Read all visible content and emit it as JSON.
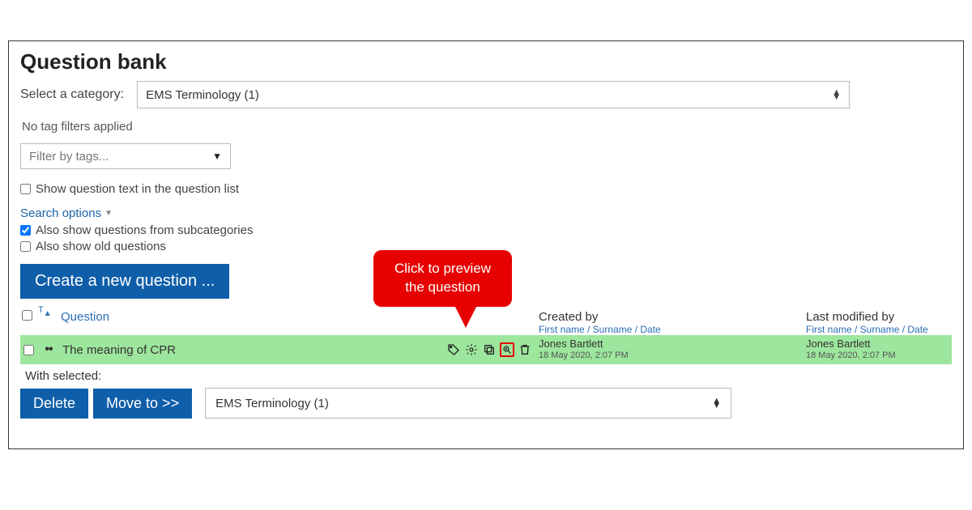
{
  "page": {
    "title": "Question bank"
  },
  "category": {
    "label": "Select a category:",
    "selected": "EMS Terminology (1)"
  },
  "tags": {
    "none_applied": "No tag filters applied",
    "placeholder": "Filter by tags..."
  },
  "options": {
    "show_text": {
      "label": "Show question text in the question list",
      "checked": false
    },
    "search_options": "Search options",
    "subcats": {
      "label": "Also show questions from subcategories",
      "checked": true
    },
    "old": {
      "label": "Also show old questions",
      "checked": false
    }
  },
  "create_button": "Create a new question ...",
  "table": {
    "type_abbr": "T",
    "question_header": "Question",
    "created_header": "Created by",
    "modified_header": "Last modified by",
    "sub_header": "First name / Surname / Date",
    "row": {
      "name": "The meaning of CPR",
      "created_by": "Jones Bartlett",
      "created_date": "18 May 2020, 2:07 PM",
      "modified_by": "Jones Bartlett",
      "modified_date": "18 May 2020, 2:07 PM"
    }
  },
  "with_selected": {
    "label": "With selected:",
    "delete": "Delete",
    "move": "Move to >>",
    "move_target": "EMS Terminology (1)"
  },
  "callout": "Click to preview\nthe question"
}
